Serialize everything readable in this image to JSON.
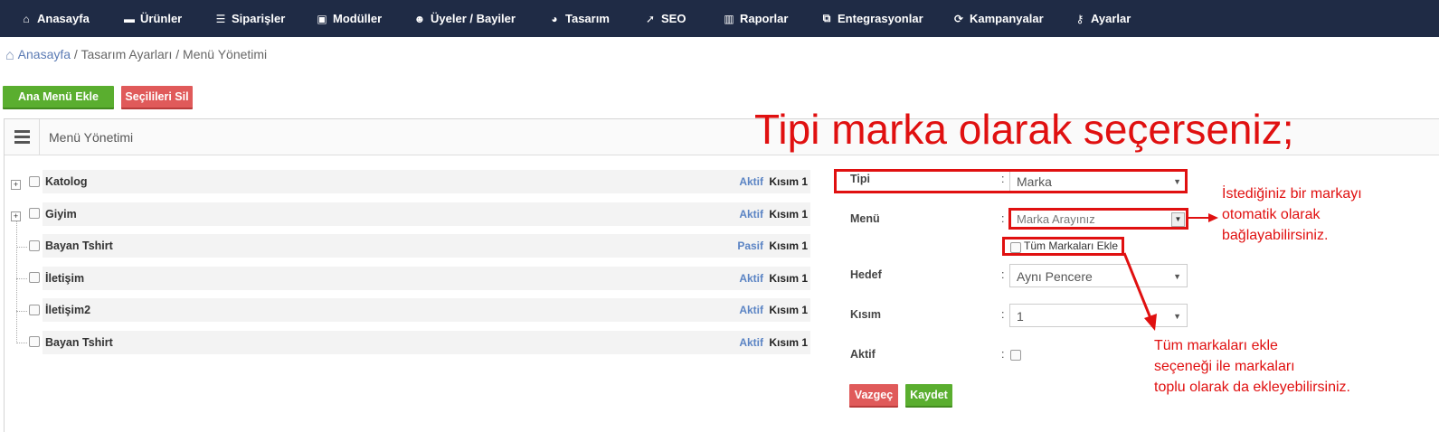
{
  "nav": [
    {
      "label": "Anasayfa",
      "icon": "home-icon",
      "glyph": "⌂"
    },
    {
      "label": "Ürünler",
      "icon": "folder-icon",
      "glyph": "▬"
    },
    {
      "label": "Siparişler",
      "icon": "list-icon",
      "glyph": "☰"
    },
    {
      "label": "Modüller",
      "icon": "box-icon",
      "glyph": "▣"
    },
    {
      "label": "Üyeler / Bayiler",
      "icon": "user-icon",
      "glyph": "☻"
    },
    {
      "label": "Tasarım",
      "icon": "palette-icon",
      "glyph": "◕"
    },
    {
      "label": "SEO",
      "icon": "rocket-icon",
      "glyph": "➚"
    },
    {
      "label": "Raporlar",
      "icon": "chart-icon",
      "glyph": "▥"
    },
    {
      "label": "Entegrasyonlar",
      "icon": "copy-icon",
      "glyph": "⧉"
    },
    {
      "label": "Kampanyalar",
      "icon": "refresh-icon",
      "glyph": "⟳"
    },
    {
      "label": "Ayarlar",
      "icon": "key-icon",
      "glyph": "⚷"
    }
  ],
  "breadcrumb": {
    "home": "Anasayfa",
    "sep1": " / ",
    "item1": "Tasarım Ayarları",
    "sep2": " / ",
    "item2": "Menü Yönetimi"
  },
  "actions": {
    "add_main_menu": "Ana Menü Ekle",
    "delete_selected": "Seçilileri Sil"
  },
  "panel": {
    "title": "Menü Yönetimi"
  },
  "tree": [
    {
      "name": "Katolog",
      "status": "Aktif",
      "kisim": "Kısım 1"
    },
    {
      "name": "Giyim",
      "status": "Aktif",
      "kisim": "Kısım 1"
    },
    {
      "name": "Bayan Tshirt",
      "status": "Pasif",
      "kisim": "Kısım 1"
    },
    {
      "name": "İletişim",
      "status": "Aktif",
      "kisim": "Kısım 1"
    },
    {
      "name": "İletişim2",
      "status": "Aktif",
      "kisim": "Kısım 1"
    },
    {
      "name": "Bayan Tshirt",
      "status": "Aktif",
      "kisim": "Kısım 1"
    }
  ],
  "form": {
    "tipi_label": "Tipi",
    "tipi_value": "Marka",
    "menu_label": "Menü",
    "menu_placeholder": "Marka Arayınız",
    "all_brands_label": "Tüm Markaları Ekle",
    "hedef_label": "Hedef",
    "hedef_value": "Aynı Pencere",
    "kisim_label": "Kısım",
    "kisim_value": "1",
    "aktif_label": "Aktif",
    "colon": ":",
    "cancel": "Vazgeç",
    "save": "Kaydet"
  },
  "annotations": {
    "title": "Tipi marka olarak seçerseniz;",
    "note1": [
      "İstediğiniz bir markayı",
      "otomatik olarak",
      "bağlayabilirsiniz."
    ],
    "note2": [
      "Tüm markaları ekle",
      "seçeneği ile markaları",
      "toplu olarak da ekleyebilirsiniz."
    ]
  },
  "colors": {
    "nav_bg": "#1f2b45",
    "accent_green": "#5aae2f",
    "accent_red": "#e05a5a",
    "annotation_red": "#e01010",
    "status_blue": "#5b84c4"
  }
}
